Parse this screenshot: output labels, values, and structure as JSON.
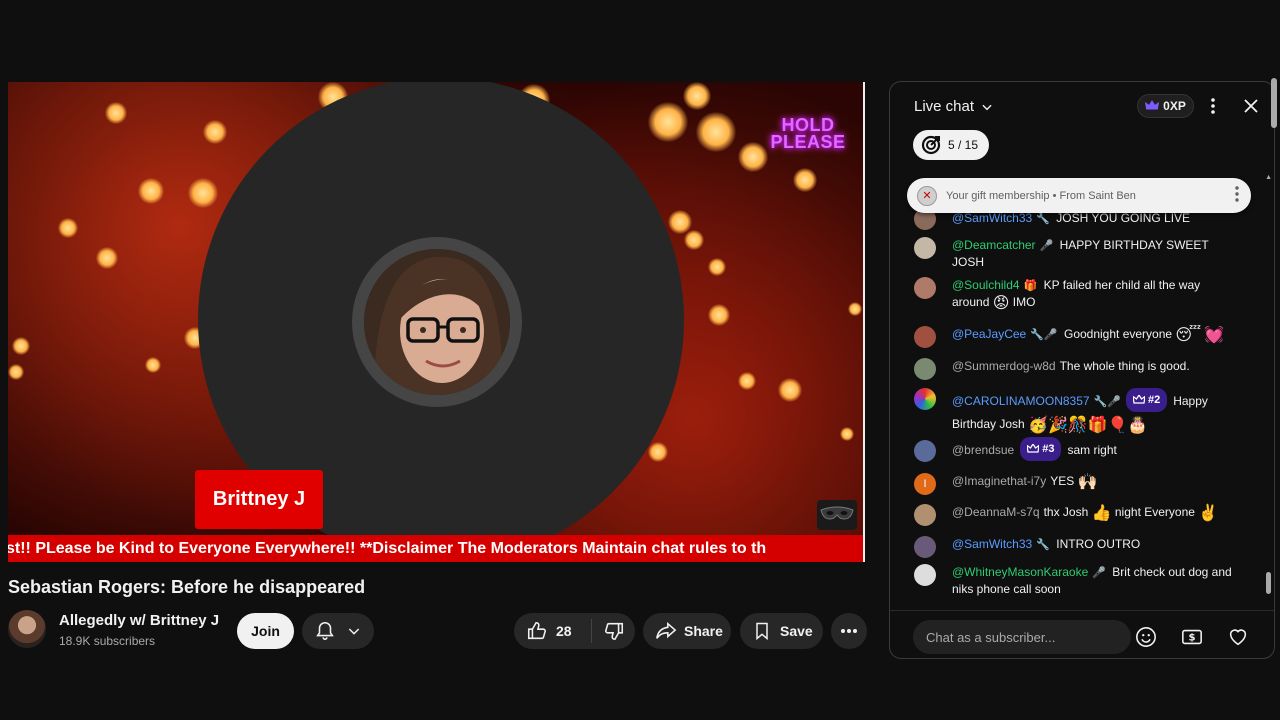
{
  "video": {
    "overlay_hold_text": "HOLD PLEASE",
    "name_tag": "Brittney J",
    "ticker": "st!! PLease be Kind to Everyone Everywhere!! **Disclaimer The Moderators Maintain chat rules to th",
    "title": "Sebastian Rogers: Before he disappeared"
  },
  "channel": {
    "name": "Allegedly w/ Brittney J",
    "subscribers": "18.9K subscribers",
    "join_label": "Join"
  },
  "actions": {
    "like_count": "28",
    "share_label": "Share",
    "save_label": "Save"
  },
  "chat": {
    "title": "Live chat",
    "xp": "0XP",
    "progress": "5 / 15",
    "gift_banner": "Your gift membership • From Saint Ben",
    "input_placeholder": "Chat as a subscriber...",
    "messages": [
      {
        "author": "@SamWitch33",
        "text": "JOSH YOU GOING LIVE"
      },
      {
        "author": "@Deamcatcher",
        "text": "HAPPY BIRTHDAY SWEET JOSH"
      },
      {
        "author": "@Soulchild4",
        "text": "KP failed her child all the way around",
        "text_after": "IMO"
      },
      {
        "author": "@PeaJayCee",
        "text": "Goodnight everyone"
      },
      {
        "author": "@Summerdog-w8d",
        "text": "The whole thing is good."
      },
      {
        "author": "@CAROLINAMOON8357",
        "rank": "#2",
        "text": "Happy Birthday Josh"
      },
      {
        "author": "@brendsue",
        "rank": "#3",
        "text": "sam right"
      },
      {
        "author": "@Imaginethat-i7y",
        "text": "YES"
      },
      {
        "author": "@DeannaM-s7q",
        "text": "thx Josh",
        "text_after": "night Everyone"
      },
      {
        "author": "@SamWitch33",
        "text": "INTRO OUTRO"
      },
      {
        "author": "@WhitneyMasonKaraoke",
        "text": "Brit check out dog and niks phone call soon"
      }
    ]
  },
  "colors": {
    "background": "#0f0f0f",
    "accent_red": "#e00000",
    "author_blue": "#5b9cff",
    "author_green": "#2ecc71",
    "rank_purple": "#3a1f8c"
  }
}
